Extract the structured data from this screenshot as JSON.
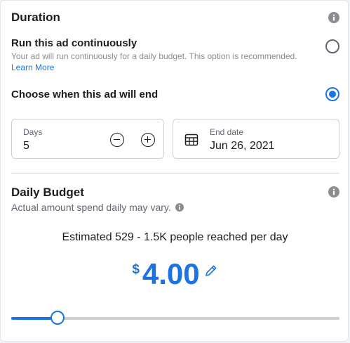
{
  "duration": {
    "title": "Duration",
    "continuous": {
      "title": "Run this ad continuously",
      "description": "Your ad will run continuously for a daily budget. This option is recommended.",
      "link": "Learn More",
      "selected": false
    },
    "end_option": {
      "title": "Choose when this ad will end",
      "selected": true
    },
    "days_field": {
      "label": "Days",
      "value": "5"
    },
    "end_date_field": {
      "label": "End date",
      "value": "Jun 26, 2021"
    }
  },
  "budget": {
    "title": "Daily Budget",
    "subtitle": "Actual amount spend daily may vary.",
    "estimate": "Estimated 529 - 1.5K people reached per day",
    "currency": "$",
    "amount": "4.00",
    "slider_fraction": 0.14
  },
  "icons": [
    "info-icon",
    "minus-circle-icon",
    "plus-circle-icon",
    "calendar-icon",
    "pencil-icon"
  ],
  "colors": {
    "accent": "#1b74e4",
    "text": "#1c1e21",
    "muted": "#606770"
  }
}
